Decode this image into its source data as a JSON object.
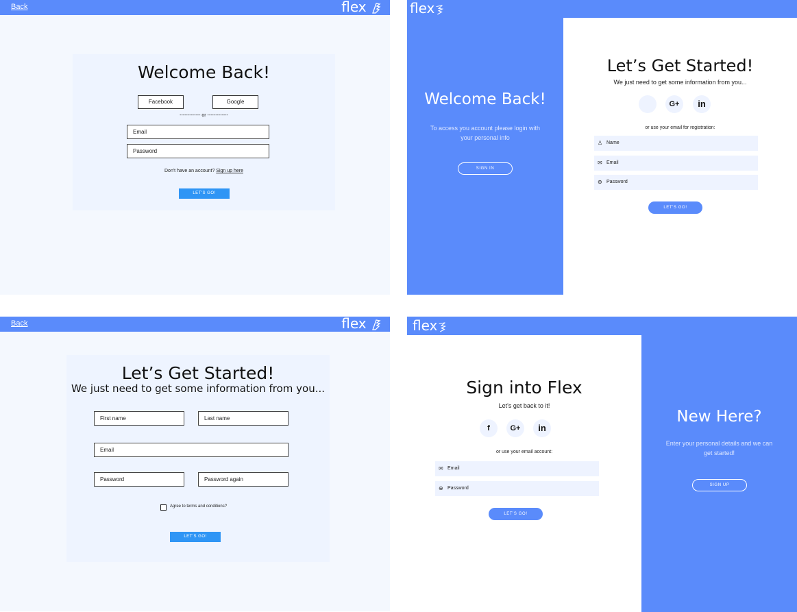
{
  "brand": {
    "name": "flex"
  },
  "q1": {
    "back": "Back",
    "title": "Welcome Back!",
    "facebook": "Facebook",
    "google": "Google",
    "or": "------------- or -------------",
    "email": "Email",
    "password": "Password",
    "no_account": "Don't have an account?",
    "signup_link": "Sign up here",
    "submit": "LET'S GO!"
  },
  "q2": {
    "left_title": "Welcome Back!",
    "left_text": "To access you account please login with your personal info",
    "signin": "SIGN IN",
    "title": "Let’s Get Started!",
    "subtitle": "We just need to get some information from you...",
    "google": "G+",
    "linkedin": "in",
    "or_text": "or use your email for registration:",
    "name": "Name",
    "email": "Email",
    "password": "Password",
    "submit": "LET'S GO!"
  },
  "q3": {
    "back": "Back",
    "title": "Let’s Get Started!",
    "subtitle": "We just need to get some information from you...",
    "first_name": "First name",
    "last_name": "Last name",
    "email": "Email",
    "password": "Password",
    "password_again": "Password again",
    "terms": "Agree to terms and conditions?",
    "submit": "LET'S GO!"
  },
  "q4": {
    "title": "Sign into Flex",
    "subtitle": "Let's get back to it!",
    "facebook": "f",
    "google": "G+",
    "linkedin": "in",
    "or_text": "or use your email account:",
    "email": "Email",
    "password": "Password",
    "submit": "LET'S GO!",
    "right_title": "New Here?",
    "right_text": "Enter your personal details and we can get started!",
    "signup": "SIGN UP"
  },
  "colors": {
    "accent": "#5a8bfb",
    "button": "#2f95f5",
    "card": "#eef4ff"
  }
}
